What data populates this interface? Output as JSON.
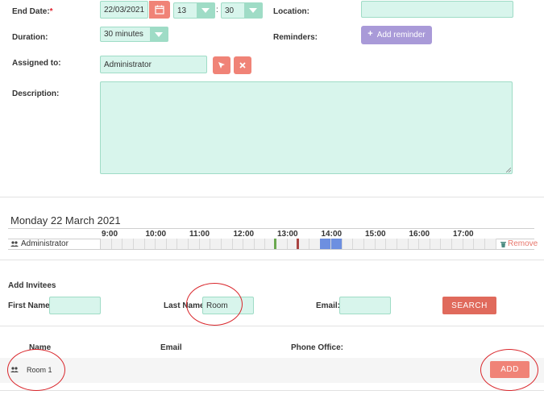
{
  "form": {
    "end_date_label": "End Date:",
    "required_mark": "*",
    "end_date_value": "22/03/2021",
    "hour_value": "13",
    "time_sep": ":",
    "minute_value": "30",
    "location_label": "Location:",
    "location_value": "",
    "duration_label": "Duration:",
    "duration_value": "30 minutes",
    "reminders_label": "Reminders:",
    "add_reminder_label": "Add reminder",
    "add_reminder_plus": "+",
    "assigned_label": "Assigned to:",
    "assigned_value": "Administrator",
    "description_label": "Description:",
    "description_value": ""
  },
  "scheduler": {
    "date_title": "Monday 22 March 2021",
    "hours": [
      "9:00",
      "10:00",
      "11:00",
      "12:00",
      "13:00",
      "14:00",
      "15:00",
      "16:00",
      "17:00"
    ],
    "attendee": "Administrator",
    "remove_label": "Remove",
    "colors": {
      "green": "#6aa84f",
      "red": "#a94442",
      "blue": "#6d8fe0"
    }
  },
  "invitees": {
    "title": "Add Invitees",
    "first_name_label": "First Name:",
    "first_name_value": "",
    "last_name_label": "Last Name:",
    "last_name_value": "Room",
    "email_label": "Email:",
    "email_value": "",
    "search_label": "SEARCH"
  },
  "results": {
    "col_name": "Name",
    "col_email": "Email",
    "col_phone": "Phone Office:",
    "rows": [
      {
        "name": "Room 1"
      }
    ],
    "add_label": "ADD"
  }
}
